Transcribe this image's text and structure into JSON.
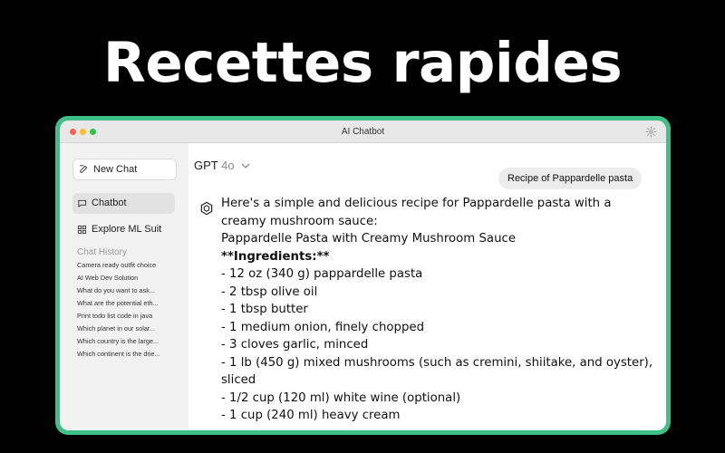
{
  "headline": "Recettes rapides",
  "window": {
    "title": "AI Chatbot"
  },
  "sidebar": {
    "new_chat": "New Chat",
    "nav": [
      {
        "label": "Chatbot"
      },
      {
        "label": "Explore ML Suit"
      }
    ],
    "history_title": "Chat History",
    "history": [
      "Camera ready outfit choice",
      "AI Web Dev Solution",
      "What do you want to ask...",
      "What are the potential eth...",
      "Print todo list code in java",
      "Which planet in our solar...",
      "Which country is the large...",
      "Which continent is the drie..."
    ]
  },
  "main": {
    "model_name": "GPT",
    "model_version": "4o",
    "user_message": "Recipe of  Pappardelle pasta",
    "answer_lines": [
      "Here's a simple and delicious recipe for Pappardelle pasta with a",
      "creamy mushroom sauce:",
      "Pappardelle Pasta with Creamy Mushroom Sauce",
      "**Ingredients:**",
      "- 12 oz (340 g) pappardelle pasta",
      "- 2 tbsp olive oil",
      "- 1 tbsp butter",
      "- 1 medium onion, finely chopped",
      "- 3 cloves garlic, minced",
      "- 1 lb (450 g) mixed mushrooms (such as cremini, shiitake, and oyster),",
      "sliced",
      "- 1/2 cup (120 ml) white wine (optional)",
      "- 1 cup (240 ml) heavy cream"
    ]
  },
  "colors": {
    "frame_accent": "#3fc089",
    "background": "#000000",
    "sidebar": "#f2f2f2"
  }
}
